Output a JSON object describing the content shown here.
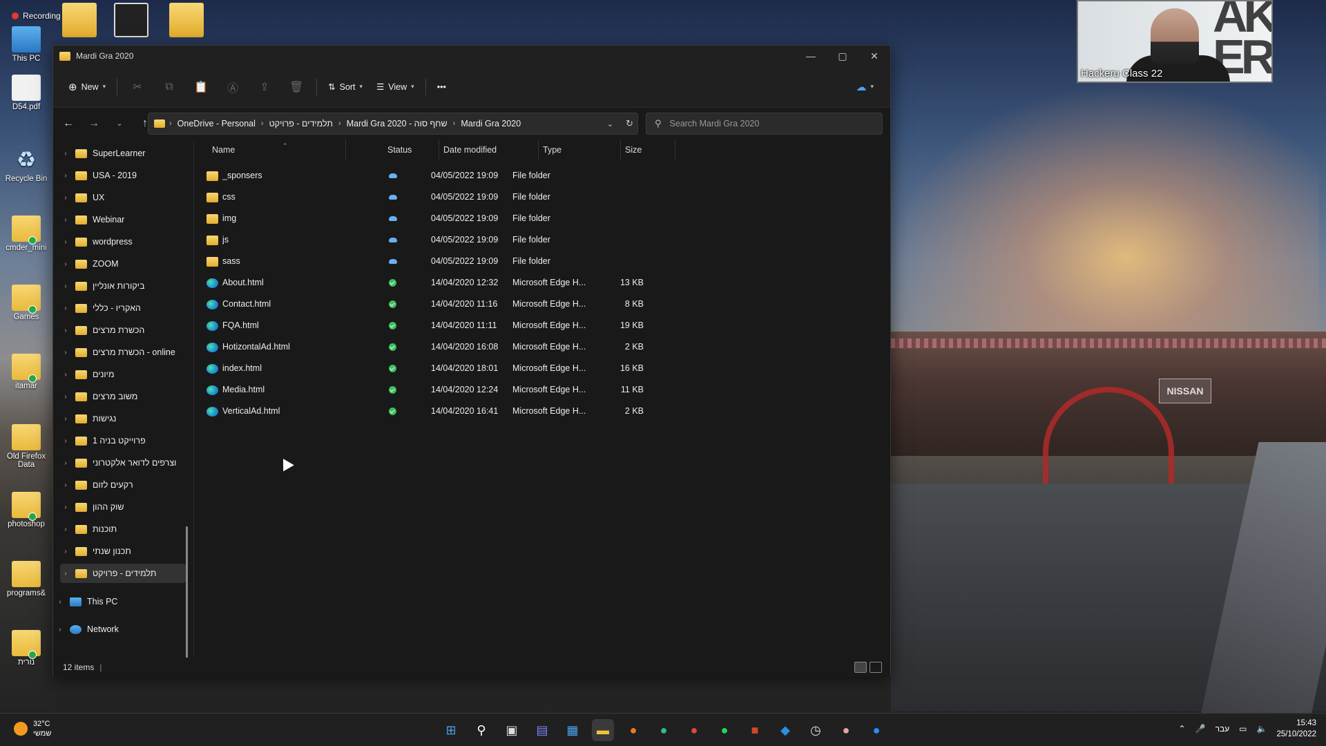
{
  "recording": {
    "label": "Recording"
  },
  "desktop": {
    "icons": [
      {
        "label": "This PC",
        "type": "pc"
      },
      {
        "label": "D54.pdf",
        "type": "pdf"
      },
      {
        "label": "Recycle Bin",
        "type": "bin"
      },
      {
        "label": "cmder_mini",
        "type": "folder"
      },
      {
        "label": "Games",
        "type": "folder"
      },
      {
        "label": "itamar",
        "type": "folder"
      },
      {
        "label": "Old Firefox Data",
        "type": "folder"
      },
      {
        "label": "photoshop",
        "type": "folder"
      },
      {
        "label": "programs&",
        "type": "folder"
      },
      {
        "label": "נורית",
        "type": "folder"
      }
    ]
  },
  "webcam": {
    "label": "Hackeru Class 22"
  },
  "window": {
    "title": "Mardi Gra 2020",
    "controls": {
      "minimize": "—",
      "maximize": "▢",
      "close": "✕"
    },
    "toolbar": {
      "new_label": "New",
      "sort_label": "Sort",
      "view_label": "View",
      "more_label": "•••"
    },
    "address": {
      "crumbs": [
        "OneDrive - Personal",
        "תלמידים - פרויקט",
        "Mardi Gra 2020 - שחף סוה",
        "Mardi Gra 2020"
      ]
    },
    "search": {
      "placeholder": "Search Mardi Gra 2020"
    },
    "nav_items": [
      {
        "label": "SuperLearner"
      },
      {
        "label": "USA - 2019"
      },
      {
        "label": "UX"
      },
      {
        "label": "Webinar"
      },
      {
        "label": "wordpress"
      },
      {
        "label": "ZOOM"
      },
      {
        "label": "ביקורות אונליין"
      },
      {
        "label": "האקריו - כללי"
      },
      {
        "label": "הכשרת מרצים"
      },
      {
        "label": "הכשרת מרצים - online"
      },
      {
        "label": "מיונים"
      },
      {
        "label": "משוב מרצים"
      },
      {
        "label": "נגישות"
      },
      {
        "label": "פרוייקט בניה 1"
      },
      {
        "label": "וצרפים לדואר אלקטרוני"
      },
      {
        "label": "רקעים לזום"
      },
      {
        "label": "שוק ההון"
      },
      {
        "label": "תוכנות"
      },
      {
        "label": "תכנון שנתי"
      },
      {
        "label": "תלמידים - פרויקט"
      }
    ],
    "nav_roots": [
      {
        "label": "This PC"
      },
      {
        "label": "Network"
      }
    ],
    "columns": [
      "Name",
      "Status",
      "Date modified",
      "Type",
      "Size"
    ],
    "files": [
      {
        "name": "_sponsers",
        "status": "cloud",
        "date": "04/05/2022 19:09",
        "type": "File folder",
        "size": "",
        "kind": "folder"
      },
      {
        "name": "css",
        "status": "cloud",
        "date": "04/05/2022 19:09",
        "type": "File folder",
        "size": "",
        "kind": "folder"
      },
      {
        "name": "img",
        "status": "cloud",
        "date": "04/05/2022 19:09",
        "type": "File folder",
        "size": "",
        "kind": "folder"
      },
      {
        "name": "js",
        "status": "cloud",
        "date": "04/05/2022 19:09",
        "type": "File folder",
        "size": "",
        "kind": "folder"
      },
      {
        "name": "sass",
        "status": "cloud",
        "date": "04/05/2022 19:09",
        "type": "File folder",
        "size": "",
        "kind": "folder"
      },
      {
        "name": "About.html",
        "status": "synced",
        "date": "14/04/2020 12:32",
        "type": "Microsoft Edge H...",
        "size": "13 KB",
        "kind": "edge"
      },
      {
        "name": "Contact.html",
        "status": "synced",
        "date": "14/04/2020 11:16",
        "type": "Microsoft Edge H...",
        "size": "8 KB",
        "kind": "edge"
      },
      {
        "name": "FQA.html",
        "status": "synced",
        "date": "14/04/2020 11:11",
        "type": "Microsoft Edge H...",
        "size": "19 KB",
        "kind": "edge"
      },
      {
        "name": "HotizontalAd.html",
        "status": "synced",
        "date": "14/04/2020 16:08",
        "type": "Microsoft Edge H...",
        "size": "2 KB",
        "kind": "edge"
      },
      {
        "name": "index.html",
        "status": "synced",
        "date": "14/04/2020 18:01",
        "type": "Microsoft Edge H...",
        "size": "16 KB",
        "kind": "edge"
      },
      {
        "name": "Media.html",
        "status": "synced",
        "date": "14/04/2020 12:24",
        "type": "Microsoft Edge H...",
        "size": "11 KB",
        "kind": "edge"
      },
      {
        "name": "VerticalAd.html",
        "status": "synced",
        "date": "14/04/2020 16:41",
        "type": "Microsoft Edge H...",
        "size": "2 KB",
        "kind": "edge"
      }
    ],
    "status_bar": {
      "count": "12 items"
    }
  },
  "taskbar": {
    "weather": {
      "temp": "32°C",
      "desc": "שמשי"
    },
    "lang": "עבר",
    "time": "15:43",
    "date": "25/10/2022"
  },
  "colors": {
    "accent": "#0078d4",
    "synced": "#3fbf5b",
    "cloud": "#6ab0f0"
  }
}
